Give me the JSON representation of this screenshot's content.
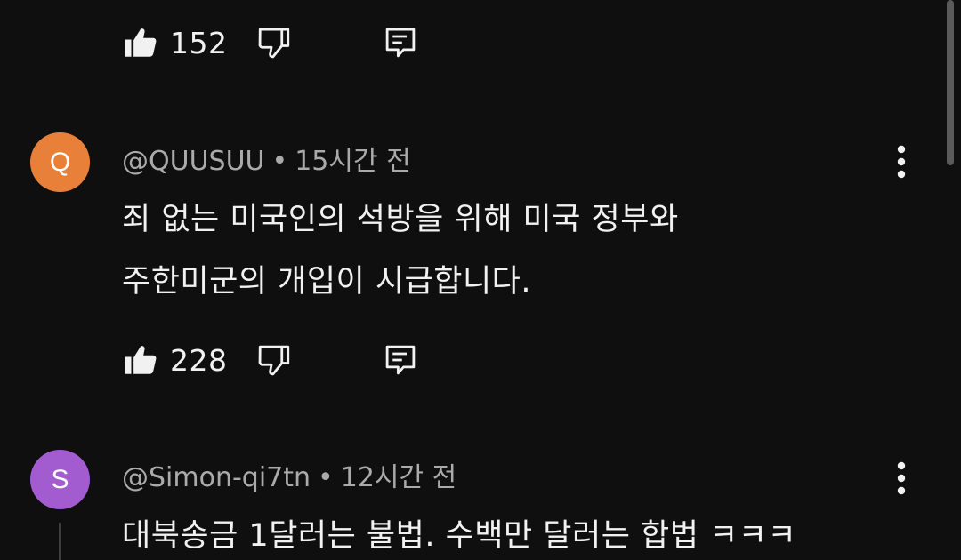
{
  "comments": [
    {
      "likes": "152"
    },
    {
      "avatar_letter": "Q",
      "avatar_color": "#e8803a",
      "author": "@QUUSUU",
      "separator": "•",
      "time": "15시간 전",
      "lines": [
        "죄 없는 미국인의 석방을 위해 미국 정부와",
        "주한미군의 개입이 시급합니다."
      ],
      "likes": "228"
    },
    {
      "avatar_letter": "S",
      "avatar_color": "#a35bd0",
      "author": "@Simon-qi7tn",
      "separator": "•",
      "time": "12시간 전",
      "lines": [
        "대북송금 1달러는 불법. 수백만 달러는 합법 ㅋㅋㅋ"
      ]
    }
  ],
  "icons": {
    "like": "thumbs-up-icon",
    "dislike": "thumbs-down-icon",
    "reply": "reply-comment-icon",
    "more": "more-vertical-icon"
  },
  "colors": {
    "background": "#0f0f0f",
    "text": "#f1f1f1",
    "meta_text": "#aaaaaa"
  }
}
